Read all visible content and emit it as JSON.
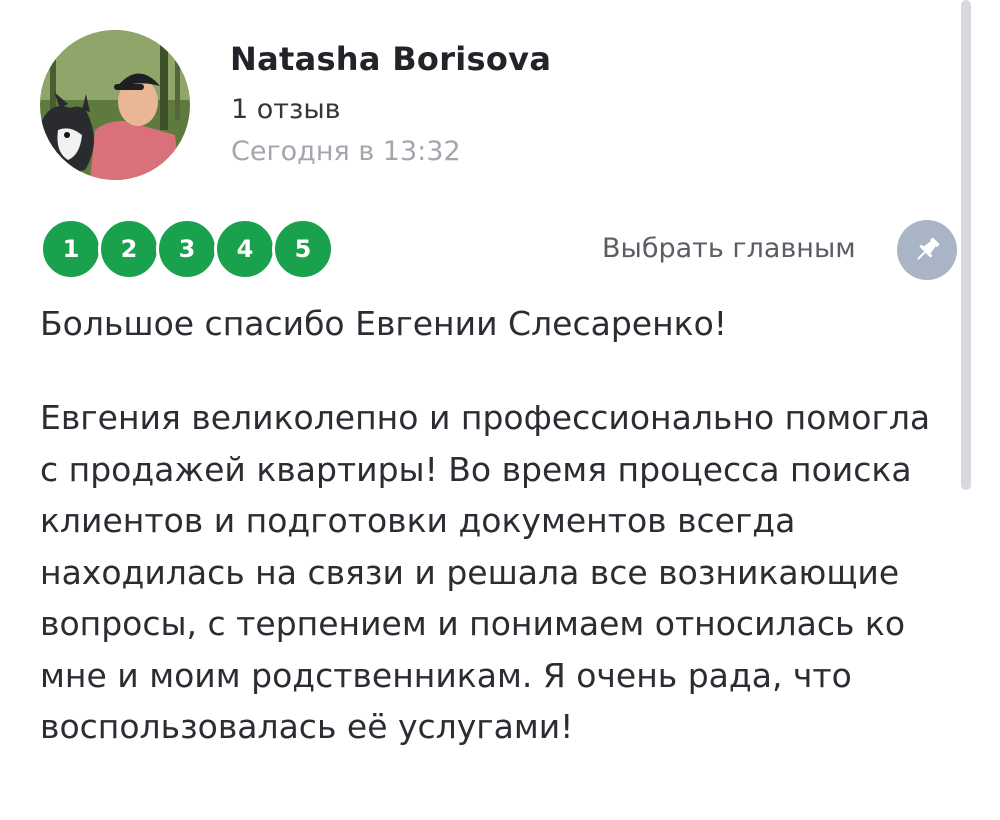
{
  "author": {
    "name": "Natasha Borisova",
    "review_count": "1 отзыв",
    "date": "Сегодня в 13:32"
  },
  "rating": {
    "options": [
      "1",
      "2",
      "3",
      "4",
      "5"
    ],
    "selected": 5,
    "color": "#1aa14e"
  },
  "actions": {
    "pick_main_label": "Выбрать главным",
    "pin_icon": "pin-icon",
    "pin_color": "#a9b4c6"
  },
  "review": {
    "title": "Большое спасибо Евгении Слесаренко!",
    "text": "Евгения великолепно и профессионально помогла с продажей квартиры! Во время процесса поиска клиентов и подготовки документов всегда находилась на связи и решала все возникающие вопросы, с терпением и понимаем относилась ко мне и моим родственникам. Я очень рада, что воспользовалась её услугами!"
  }
}
